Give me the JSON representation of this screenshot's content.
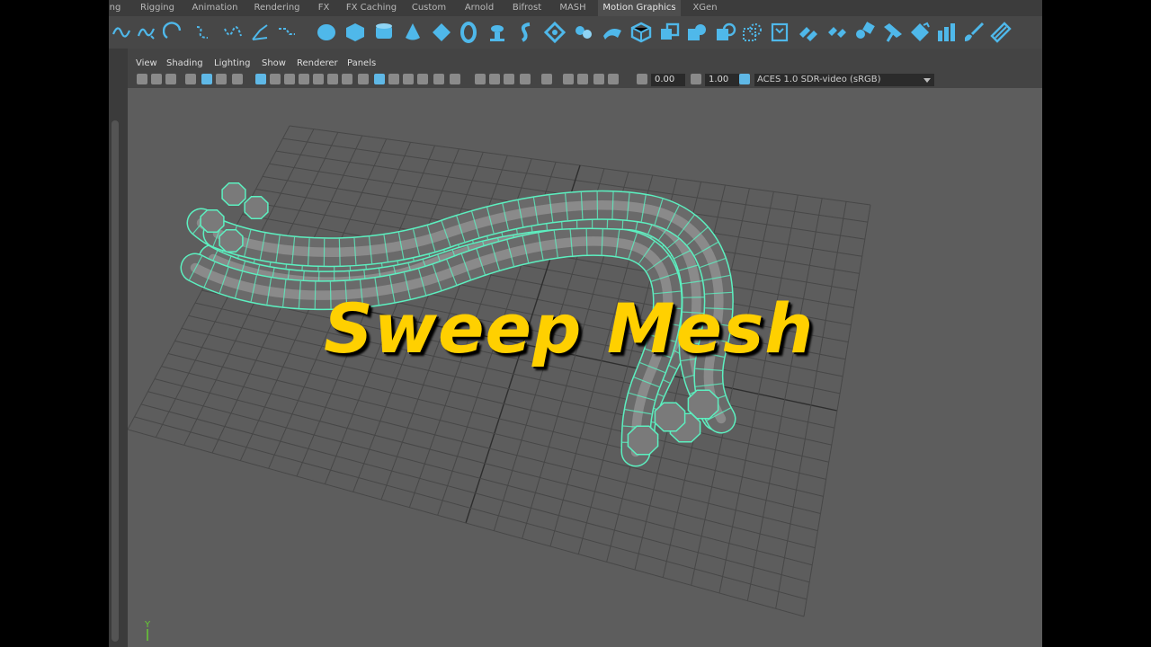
{
  "shelf": {
    "tabs": [
      {
        "label": "ng"
      },
      {
        "label": "Rigging"
      },
      {
        "label": "Animation"
      },
      {
        "label": "Rendering"
      },
      {
        "label": "FX"
      },
      {
        "label": "FX Caching"
      },
      {
        "label": "Custom"
      },
      {
        "label": "Arnold"
      },
      {
        "label": "Bifrost"
      },
      {
        "label": "MASH"
      },
      {
        "label": "Motion Graphics",
        "active": true
      },
      {
        "label": "XGen"
      }
    ],
    "icons": [
      "cv-curve-icon",
      "ep-curve-icon",
      "bezier-icon",
      "pencil-curve-icon",
      "arc-icon",
      "curve-edit-icon",
      "sweep-icon",
      "sphere-icon",
      "cube-icon",
      "cylinder-icon",
      "cone-icon",
      "plane-icon",
      "torus-icon",
      "type-icon",
      "svg-icon",
      "poly-sweep-icon",
      "spline-icon",
      "bend-icon",
      "box-icon",
      "combine-icon",
      "separate-icon",
      "extract-icon",
      "boolean-icon",
      "smooth-icon",
      "bevel-icon",
      "bridge-icon",
      "extrude-icon",
      "multi-cut-icon",
      "target-weld-icon",
      "sculpt-icon",
      "brush-icon",
      "paint-icon",
      "grease-icon"
    ],
    "accent_color": "#4fb8ea"
  },
  "panel": {
    "menus": [
      "View",
      "Shading",
      "Lighting",
      "Show",
      "Renderer",
      "Panels"
    ],
    "exposure": "0.00",
    "gamma": "1.00",
    "color_space": "ACES 1.0 SDR-video (sRGB)"
  },
  "viewport": {
    "overlay_title": "Sweep Mesh",
    "title_color": "#ffd000",
    "wire_color": "#5cf0c0",
    "axis": {
      "y_label": "Y"
    }
  }
}
